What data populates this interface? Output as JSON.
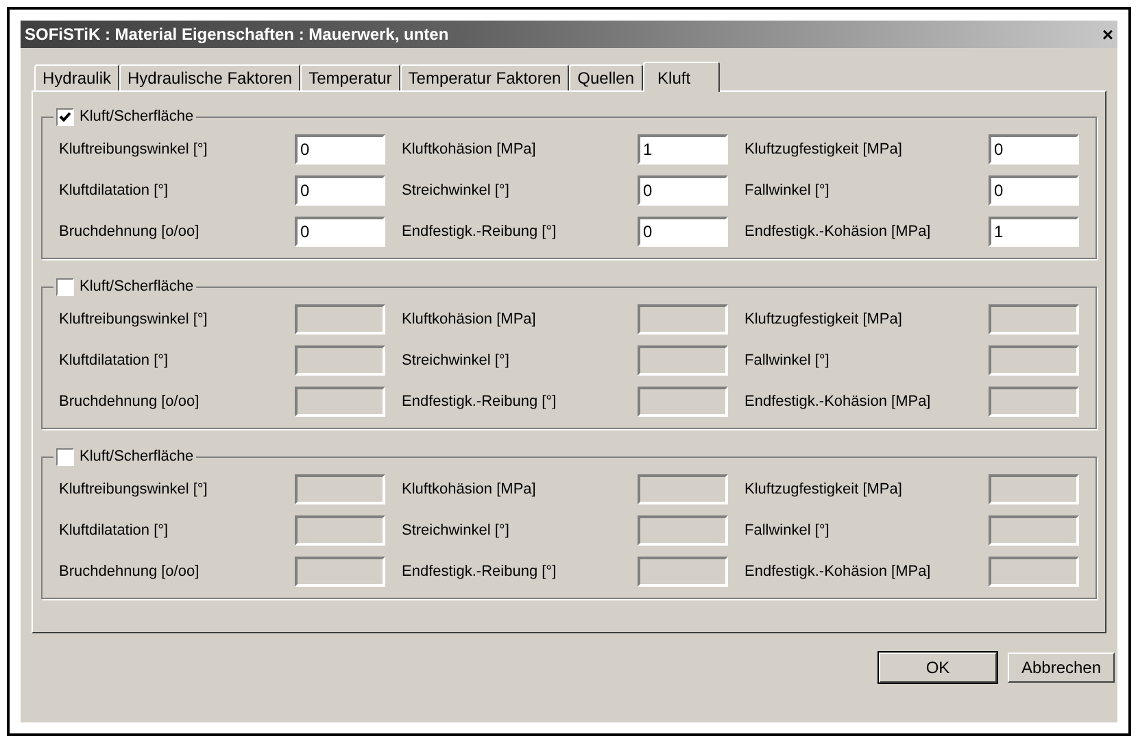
{
  "window": {
    "title": "SOFiSTiK : Material Eigenschaften : Mauerwerk, unten",
    "close": "×"
  },
  "tabs": [
    {
      "label": "Hydraulik",
      "selected": false
    },
    {
      "label": "Hydraulische Faktoren",
      "selected": false
    },
    {
      "label": "Temperatur",
      "selected": false
    },
    {
      "label": "Temperatur Faktoren",
      "selected": false
    },
    {
      "label": "Quellen",
      "selected": false
    },
    {
      "label": "Kluft",
      "selected": true
    }
  ],
  "groups": [
    {
      "label": "Kluft/Scherfläche",
      "checked": true,
      "fields": [
        {
          "label": "Kluftreibungswinkel [°]",
          "value": "0"
        },
        {
          "label": "Kluftkohäsion [MPa]",
          "value": "1"
        },
        {
          "label": "Kluftzugfestigkeit [MPa]",
          "value": "0"
        },
        {
          "label": "Kluftdilatation [°]",
          "value": "0"
        },
        {
          "label": "Streichwinkel [°]",
          "value": "0"
        },
        {
          "label": "Fallwinkel [°]",
          "value": "0"
        },
        {
          "label": "Bruchdehnung [o/oo]",
          "value": "0"
        },
        {
          "label": "Endfestigk.-Reibung [°]",
          "value": "0"
        },
        {
          "label": "Endfestigk.-Kohäsion [MPa]",
          "value": "1"
        }
      ]
    },
    {
      "label": "Kluft/Scherfläche",
      "checked": false,
      "fields": [
        {
          "label": "Kluftreibungswinkel [°]"
        },
        {
          "label": "Kluftkohäsion [MPa]"
        },
        {
          "label": "Kluftzugfestigkeit [MPa]"
        },
        {
          "label": "Kluftdilatation [°]"
        },
        {
          "label": "Streichwinkel [°]"
        },
        {
          "label": "Fallwinkel [°]"
        },
        {
          "label": "Bruchdehnung [o/oo]"
        },
        {
          "label": "Endfestigk.-Reibung [°]"
        },
        {
          "label": "Endfestigk.-Kohäsion [MPa]"
        }
      ]
    },
    {
      "label": "Kluft/Scherfläche",
      "checked": false,
      "fields": [
        {
          "label": "Kluftreibungswinkel [°]"
        },
        {
          "label": "Kluftkohäsion [MPa]"
        },
        {
          "label": "Kluftzugfestigkeit [MPa]"
        },
        {
          "label": "Kluftdilatation [°]"
        },
        {
          "label": "Streichwinkel [°]"
        },
        {
          "label": "Fallwinkel [°]"
        },
        {
          "label": "Bruchdehnung [o/oo]"
        },
        {
          "label": "Endfestigk.-Reibung [°]"
        },
        {
          "label": "Endfestigk.-Kohäsion [MPa]"
        }
      ]
    }
  ],
  "buttons": [
    "OK",
    "Abbrechen"
  ]
}
